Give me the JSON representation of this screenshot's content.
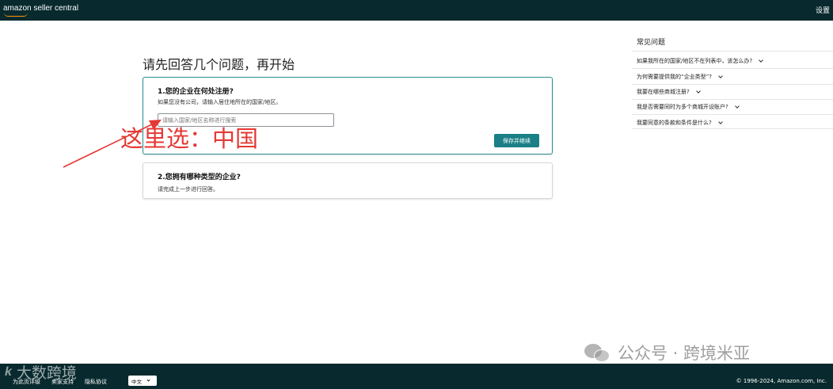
{
  "header": {
    "logo_text": "amazon seller central",
    "settings_label": "设置"
  },
  "main": {
    "title": "请先回答几个问题，再开始",
    "question1": {
      "title": "1.您的企业在何处注册?",
      "subtitle": "如果您没有公司，请输入居住地所在的国家/地区。",
      "input_placeholder": "请输入国家/地区名称进行搜索",
      "input_value": "",
      "save_label": "保存并继续"
    },
    "question2": {
      "title": "2.您拥有哪种类型的企业?",
      "subtitle": "请完成上一步进行回答。"
    }
  },
  "annotation": {
    "text": "这里选：中国",
    "color": "#e53935"
  },
  "faq": {
    "title": "常见问题",
    "items": [
      {
        "label": "如果我所在的国家/地区不在列表中，该怎么办?"
      },
      {
        "label": "为何需要提供我的“企业类型”?"
      },
      {
        "label": "我要在哪些商城注册?"
      },
      {
        "label": "我是否需要同时为多个商城开设账户?"
      },
      {
        "label": "我要同意的条款和条件是什么?"
      }
    ]
  },
  "footer": {
    "links": [
      "为此页评级",
      "卖家支持",
      "隐私协议"
    ],
    "language": "中文",
    "copyright": "© 1996-2024, Amazon.com, Inc."
  },
  "watermarks": {
    "right": "公众号 · 跨境米亚",
    "left": "大数跨境",
    "left_mark": "k"
  },
  "colors": {
    "topbar": "#082a2e",
    "primary_button": "#1a7f86",
    "active_card_border": "#2a8f93",
    "logo_accent": "#ff9900"
  }
}
